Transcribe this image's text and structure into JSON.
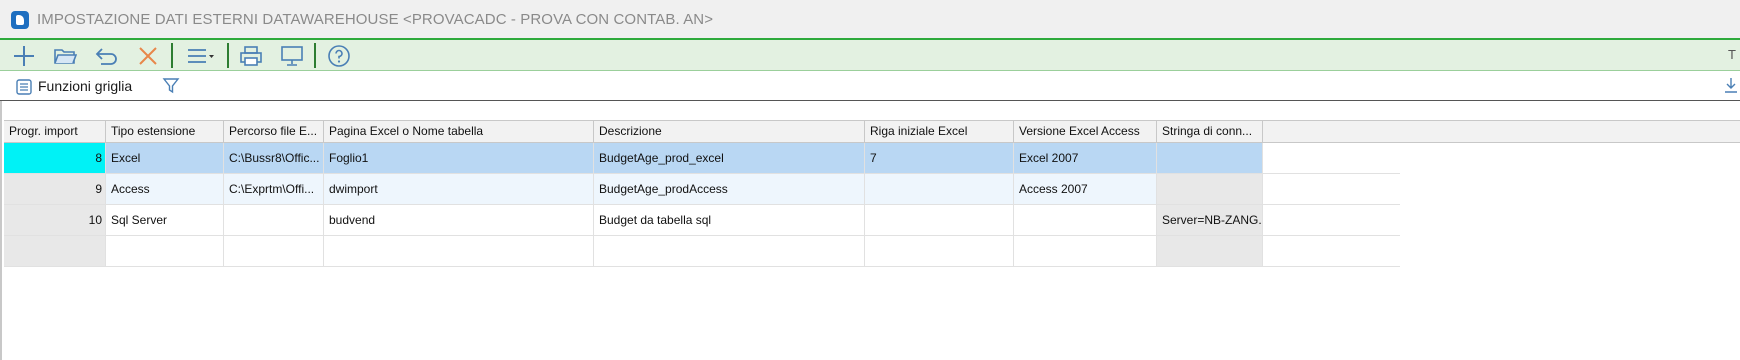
{
  "window": {
    "title": "IMPOSTAZIONE DATI ESTERNI DATAWAREHOUSE <PROVACADC - PROVA CON CONTAB. AN>"
  },
  "toolbar": {
    "right_label": "T",
    "buttons": [
      {
        "name": "add-icon"
      },
      {
        "name": "open-folder-icon"
      },
      {
        "name": "undo-icon"
      },
      {
        "name": "close-x-icon"
      },
      {
        "name": "menu-icon"
      },
      {
        "name": "print-icon"
      },
      {
        "name": "monitor-icon"
      },
      {
        "name": "help-icon"
      }
    ],
    "accent_color": "#2eaa3c"
  },
  "secondary_bar": {
    "grid_functions_label": "Funzioni griglia"
  },
  "grid": {
    "columns": [
      "Progr. import",
      "Tipo estensione",
      "Percorso file E...",
      "Pagina Excel o Nome tabella",
      "Descrizione",
      "Riga iniziale Excel",
      "Versione Excel Access",
      "Stringa di conn..."
    ],
    "rows": [
      [
        "8",
        "Excel",
        "C:\\Bussr8\\Offic...",
        "Foglio1",
        "BudgetAge_prod_excel",
        "7",
        "Excel 2007",
        ""
      ],
      [
        "9",
        "Access",
        "C:\\Exprtm\\Offi...",
        "dwimport",
        "BudgetAge_prodAccess",
        "",
        "Access 2007",
        ""
      ],
      [
        "10",
        "Sql Server",
        "",
        "budvend",
        "Budget da tabella sql",
        "",
        "",
        "Server=NB-ZANG..."
      ],
      [
        "",
        "",
        "",
        "",
        "",
        "",
        "",
        ""
      ]
    ],
    "selected_row_color": "#b9d7f3",
    "current_cell_color": "#00f2f6"
  }
}
